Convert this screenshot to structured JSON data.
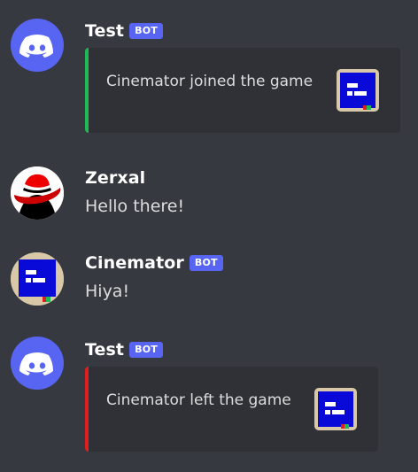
{
  "messages": [
    {
      "username": "Test",
      "bot_tag": "BOT",
      "avatar_icon": "discord-logo-icon",
      "embed": {
        "text": "Cinemator joined the game",
        "accent_color": "#1db954",
        "thumbnail_icon": "cinemator-avatar-icon"
      }
    },
    {
      "username": "Zerxal",
      "avatar_icon": "red-hat-avatar-icon",
      "text": "Hello there!"
    },
    {
      "username": "Cinemator",
      "bot_tag": "BOT",
      "avatar_icon": "cinemator-avatar-icon",
      "text": "Hiya!"
    },
    {
      "username": "Test",
      "bot_tag": "BOT",
      "avatar_icon": "discord-logo-icon",
      "embed": {
        "text": "Cinemator left the game",
        "accent_color": "#e01e1e",
        "thumbnail_icon": "cinemator-avatar-icon"
      }
    }
  ],
  "colors": {
    "background": "#36393f",
    "embed_background": "#2f3136",
    "bot_tag": "#5865f2",
    "discord_blurple": "#5865f2"
  }
}
